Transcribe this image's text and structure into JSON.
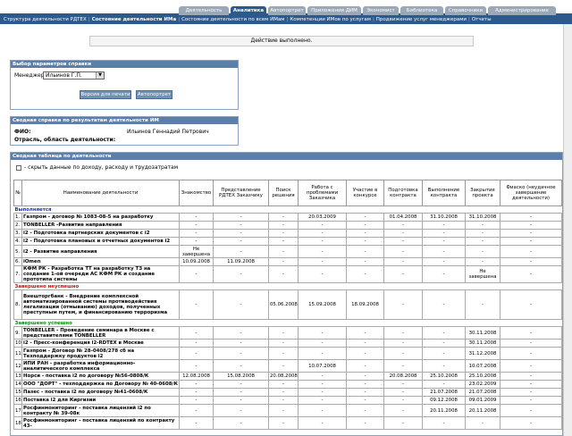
{
  "tabs": [
    "Деятельность",
    "Аналитика",
    "Автопортрет",
    "Приложения ДИМ",
    "Экономист",
    "Библиотека",
    "Справочники",
    "Администрирование"
  ],
  "subnav": [
    "Структура деятельности РДТЕХ",
    "Состояние деятельности ИМа",
    "Состояние деятельности по всем ИМам",
    "Компетенции ИМов по услугам",
    "Продвижение услуг менеджерами",
    "Отчеты"
  ],
  "status": "Действие выполнено.",
  "params": {
    "title": "Выбор параметров справки",
    "manager_label": "Менеджер",
    "manager_value": "Ильинов Г.П.",
    "btn_print": "Версия для печати",
    "btn_portrait": "Автопортрет"
  },
  "summary": {
    "title": "Сводная справка по результатам деятельности ИМ",
    "fio_label": "ФИО:",
    "fio_value": "Ильинов Геннадий Петрович",
    "branch_label": "Отрасль, область деятельности:"
  },
  "table_panel": {
    "title": "Сводная таблица по деятельности",
    "hide_label": "- скрыть данные по доходу, расходу и трудозатратам"
  },
  "columns": [
    "№",
    "Наименование деятельности",
    "Знакомство",
    "Представление РДТЕХ Заказчику",
    "Поиск решения",
    "Работа с проблемами Заказчика",
    "Участие в конкурсе",
    "Подготовка контракта",
    "Выполнение контракта",
    "Закрытие проекта",
    "Фиаско (неудачное завершение деятельности)"
  ],
  "groups": [
    {
      "title": "Выполняется",
      "color": "blue",
      "rows": [
        {
          "n": "1.",
          "name": "Газпром - договор № 1083-08-5 на разработку",
          "h": 1,
          "c": [
            "-",
            "-",
            "-",
            "20.03.2009",
            "-",
            "01.04.2008",
            "31.10.2008",
            "31.10.2008",
            "-"
          ]
        },
        {
          "n": "2.",
          "name": "TONBELLER -Развитие направления",
          "h": 1,
          "c": [
            "-",
            "-",
            "-",
            "-",
            "-",
            "-",
            "-",
            "-",
            "-"
          ]
        },
        {
          "n": "3.",
          "name": "i2 - Подготовка партнерских документов с i2",
          "h": 1,
          "c": [
            "-",
            "-",
            "-",
            "-",
            "-",
            "-",
            "-",
            "-",
            "-"
          ]
        },
        {
          "n": "4.",
          "name": "i2 - Подготовка плановых и отчетных документов i2",
          "h": 1,
          "c": [
            "-",
            "-",
            "-",
            "-",
            "-",
            "-",
            "-",
            "-",
            "-"
          ]
        },
        {
          "n": "5.",
          "name": "i2 - Развитие направления",
          "h": 2,
          "c": [
            "Не завершена",
            "-",
            "-",
            "-",
            "-",
            "-",
            "-",
            "-",
            "-"
          ]
        },
        {
          "n": "6.",
          "name": "iOmen",
          "h": 1,
          "c": [
            "10.09.2008",
            "11.09.2008",
            "-",
            "-",
            "-",
            "-",
            "-",
            "-",
            "-"
          ]
        },
        {
          "n": "7.",
          "name": "КФМ РК - Разработка ТТ на разработку ТЗ на создание 1-ой очереди АС КФМ РК и создание прототипа системы",
          "h": 2,
          "c": [
            "-",
            "-",
            "-",
            "-",
            "-",
            "-",
            "-",
            "Не завершена",
            "-"
          ]
        }
      ]
    },
    {
      "title": "Завершено неуспешно",
      "color": "red",
      "rows": [
        {
          "n": "8.",
          "name": "Внешторгбанк - Внедрение комплексной автоматизированной системы противодействия легализации (отмыванию) доходов, полученных преступным путем, и финансированию терроризма",
          "h": 5,
          "c": [
            "-",
            "-",
            "05.06.2008",
            "15.09.2008",
            "18.09.2008",
            "-",
            "-",
            "-",
            "-"
          ]
        }
      ]
    },
    {
      "title": "Завершено успешно",
      "color": "green",
      "rows": [
        {
          "n": "9.",
          "name": "TONBELLER - Проведение семинара в Москве с представителями TONBELLER",
          "h": 2,
          "c": [
            "-",
            "-",
            "-",
            "-",
            "-",
            "-",
            "-",
            "30.11.2008",
            "-"
          ]
        },
        {
          "n": "10.",
          "name": "i2 - Пресс-конференция i2-RDTEX в Москве",
          "h": 1,
          "c": [
            "-",
            "-",
            "-",
            "-",
            "-",
            "-",
            "-",
            "30.11.2008",
            "-"
          ]
        },
        {
          "n": "11.",
          "name": "Газпром - Договор № 28-0408/278 сб на Техподдержку продуктов i2",
          "h": 2,
          "c": [
            "-",
            "-",
            "-",
            "-",
            "-",
            "-",
            "-",
            "31.12.2008",
            "-"
          ]
        },
        {
          "n": "12.",
          "name": "ИПИ РАН - разработка информационно-аналитического комплекса",
          "h": 2,
          "c": [
            "-",
            "-",
            "-",
            "10.07.2008",
            "-",
            "-",
            "-",
            "10.07.2008",
            "-"
          ]
        },
        {
          "n": "13.",
          "name": "Норси - поставка i2 по договору №56-0808/К",
          "h": 1,
          "c": [
            "12.08.2008",
            "15.08.2008",
            "20.08.2008",
            "-",
            "-",
            "20.08.2008",
            "25.10.2008",
            "25.10.2008",
            "-"
          ]
        },
        {
          "n": "14.",
          "name": "ООО \"ДОРТ\" - техподдержка по Договору № 40-0608/К",
          "h": 1,
          "c": [
            "-",
            "-",
            "-",
            "-",
            "-",
            "-",
            "-",
            "23.02.2009",
            "-"
          ]
        },
        {
          "n": "15.",
          "name": "Пазес - поставка i2 по договору №41-0608/К",
          "h": 1,
          "c": [
            "-",
            "-",
            "-",
            "-",
            "-",
            "-",
            "21.07.2008",
            "21.07.2008",
            "-"
          ]
        },
        {
          "n": "16.",
          "name": "Поставка i2 для Киргизии",
          "h": 1,
          "c": [
            "-",
            "-",
            "-",
            "-",
            "-",
            "-",
            "09.12.2008",
            "09.01.2009",
            "-"
          ]
        },
        {
          "n": "17.",
          "name": "Росфинмониторинг - поставка лицензий i2 по контракту № 39-08к",
          "h": 2,
          "c": [
            "-",
            "-",
            "-",
            "-",
            "-",
            "-",
            "20.11.2008",
            "20.11.2008",
            "-"
          ]
        },
        {
          "n": "18.",
          "name": "Росфинмониторинг - поставка лицензий по контракту 43-",
          "h": 2,
          "c": [
            "-",
            "-",
            "-",
            "-",
            "-",
            "-",
            "-",
            "-",
            "-"
          ]
        }
      ]
    }
  ]
}
